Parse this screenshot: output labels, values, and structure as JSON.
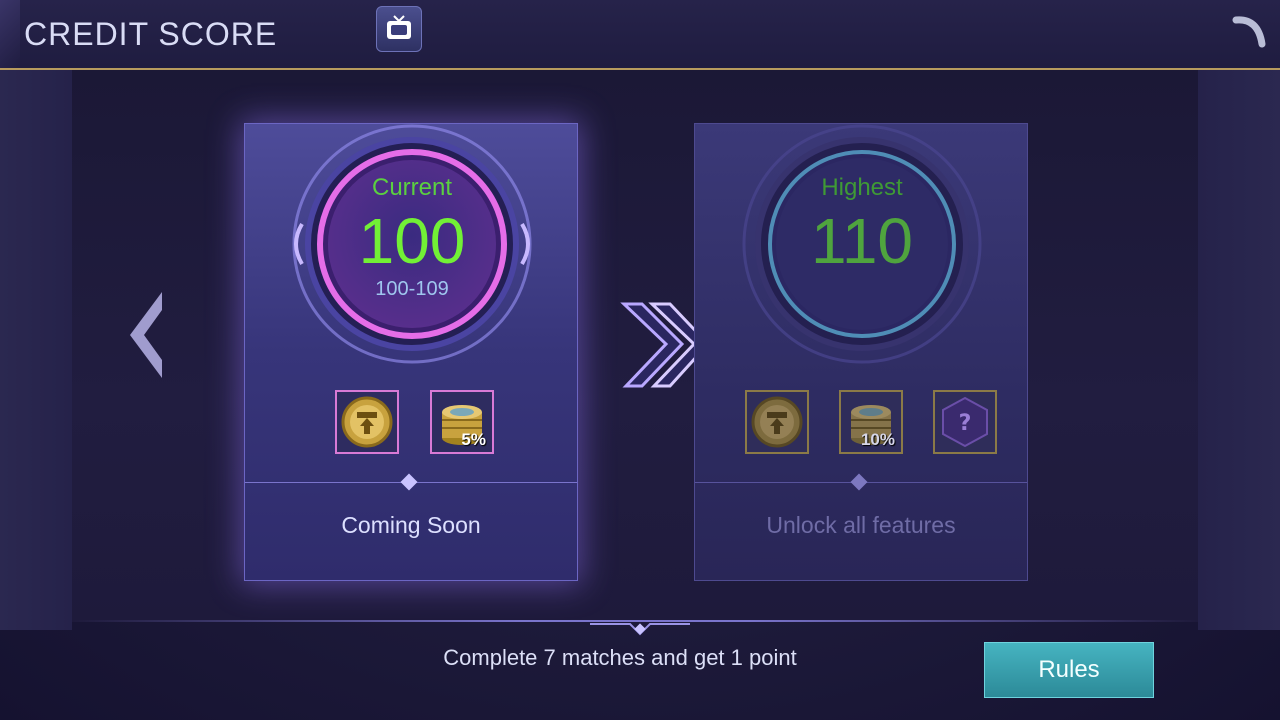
{
  "header": {
    "title": "CREDIT SCORE"
  },
  "cards": {
    "current": {
      "label": "Current",
      "score": "100",
      "range": "100-109",
      "rewards": [
        {
          "icon": "upgrade-coin-icon",
          "percent": ""
        },
        {
          "icon": "coin-stack-icon",
          "percent": "5%"
        }
      ],
      "status": "Coming Soon"
    },
    "highest": {
      "label": "Highest",
      "score": "110",
      "rewards": [
        {
          "icon": "upgrade-coin-icon",
          "percent": ""
        },
        {
          "icon": "coin-stack-icon",
          "percent": "10%"
        },
        {
          "icon": "mystery-box-icon",
          "percent": ""
        }
      ],
      "status": "Unlock all features"
    }
  },
  "footer": {
    "hint": "Complete 7 matches and get 1 point",
    "rules_label": "Rules"
  },
  "colors": {
    "accent_gold": "#b89b5e",
    "score_green": "#72f036",
    "rules_teal": "#3aa2ae"
  }
}
